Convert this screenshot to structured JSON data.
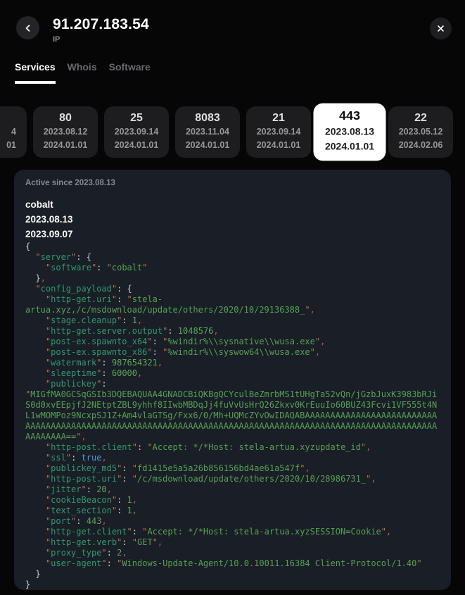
{
  "header": {
    "title": "91.207.183.54",
    "subtitle": "IP"
  },
  "icons": {
    "back": "chevron-left-icon",
    "close": "close-icon"
  },
  "tabs": [
    {
      "label": "Services",
      "active": true
    },
    {
      "label": "Whois",
      "active": false
    },
    {
      "label": "Software",
      "active": false
    }
  ],
  "service_cards": [
    {
      "port": "",
      "first_seen": "4",
      "last_seen": "01",
      "selected": false,
      "clipped": true
    },
    {
      "port": "80",
      "first_seen": "2023.08.12",
      "last_seen": "2024.01.01",
      "selected": false,
      "clipped": false
    },
    {
      "port": "25",
      "first_seen": "2023.09.14",
      "last_seen": "2024.01.01",
      "selected": false,
      "clipped": false
    },
    {
      "port": "8083",
      "first_seen": "2023.11.04",
      "last_seen": "2024.01.01",
      "selected": false,
      "clipped": false
    },
    {
      "port": "21",
      "first_seen": "2023.09.14",
      "last_seen": "2024.01.01",
      "selected": false,
      "clipped": false
    },
    {
      "port": "443",
      "first_seen": "2023.08.13",
      "last_seen": "2024.01.01",
      "selected": true,
      "clipped": false
    },
    {
      "port": "22",
      "first_seen": "2023.05.12",
      "last_seen": "2024.02.06",
      "selected": false,
      "clipped": false
    }
  ],
  "service_detail": {
    "active_since": "Active since 2023.08.13",
    "software_name": "cobalt",
    "first_seen": "2023.08.13",
    "last_seen": "2023.09.07",
    "code_lines": [
      "{",
      "  \"server\": {",
      "    \"software\": \"cobalt\"",
      "  },",
      "  \"config_payload\": {",
      "    \"http-get.uri\": \"stela-artua.xyz,/c/msdownload/update/others/2020/10/29136388_\",",
      "    \"stage.cleanup\": 1,",
      "    \"http-get.server.output\": 1048576,",
      "    \"post-ex.spawnto_x64\": \"%windir%\\\\sysnative\\\\wusa.exe\",",
      "    \"post-ex.spawnto_x86\": \"%windir%\\\\syswow64\\\\wusa.exe\",",
      "    \"watermark\": 987654321,",
      "    \"sleeptime\": 60000,",
      "    \"publickey\": \"MIGfMA0GCSqGSIb3DQEBAQUAA4GNADCBiQKBgQCYculBeZmrbMS1tUHgTa52vQn/jGzbJuxK3983bRJiS0d0xvEEpjfJ2NEtptZBL9yhhf8IIwbMBDqJj4fuVvUsHrQ26Zkxv0KrEuuIo60BUZ43Fcvi1VF555t4NL1wMOMPoz9NcxpSJ1Z+Am4vlaGTSg/Fxx6/0/Mh+UQMcZYvOwIDAQABAAAAAAAAAAAAAAAAAAAAAAAAAAAAAAAAAAAAAAAAAAAAAAAAAAAAAAAAAAAAAAAAAAAAAAAAAAAAAAAAAAAAAAAAAAAAAAAAAAAAAAAAAAAAAAAAAAA==\",",
      "    \"http-post.client\": \"Accept: */*Host: stela-artua.xyzupdate_id\",",
      "    \"ssl\": true,",
      "    \"publickey_md5\": \"fd1415e5a5a26b856156bd4ae61a547f\",",
      "    \"http-post.uri\": \"/c/msdownload/update/others/2020/10/28986731_\",",
      "    \"jitter\": 20,",
      "    \"cookieBeacon\": 1,",
      "    \"text_section\": 1,",
      "    \"port\": 443,",
      "    \"http-get.client\": \"Accept: */*Host: stela-artua.xyzSESSION=Cookie\",",
      "    \"http-get.verb\": \"GET\",",
      "    \"proxy_type\": 2,",
      "    \"user-agent\": \"Windows-Update-Agent/10.0.10011.16384 Client-Protocol/1.40\"",
      "  }",
      "}"
    ]
  },
  "colors": {
    "background": "#060606",
    "panel_bg": "#1a1e26",
    "card_bg": "#1d1d20",
    "selected_card_bg": "#ffffff",
    "tab_active_underline": "#ffffff",
    "code_key": "#2f9b70",
    "code_string": "#55a155",
    "code_number": "#5aa85a",
    "code_boolean": "#4c9bd8",
    "code_quote": "#c27442",
    "code_comma": "#bc5a49",
    "code_punct": "#ccd0d4"
  }
}
